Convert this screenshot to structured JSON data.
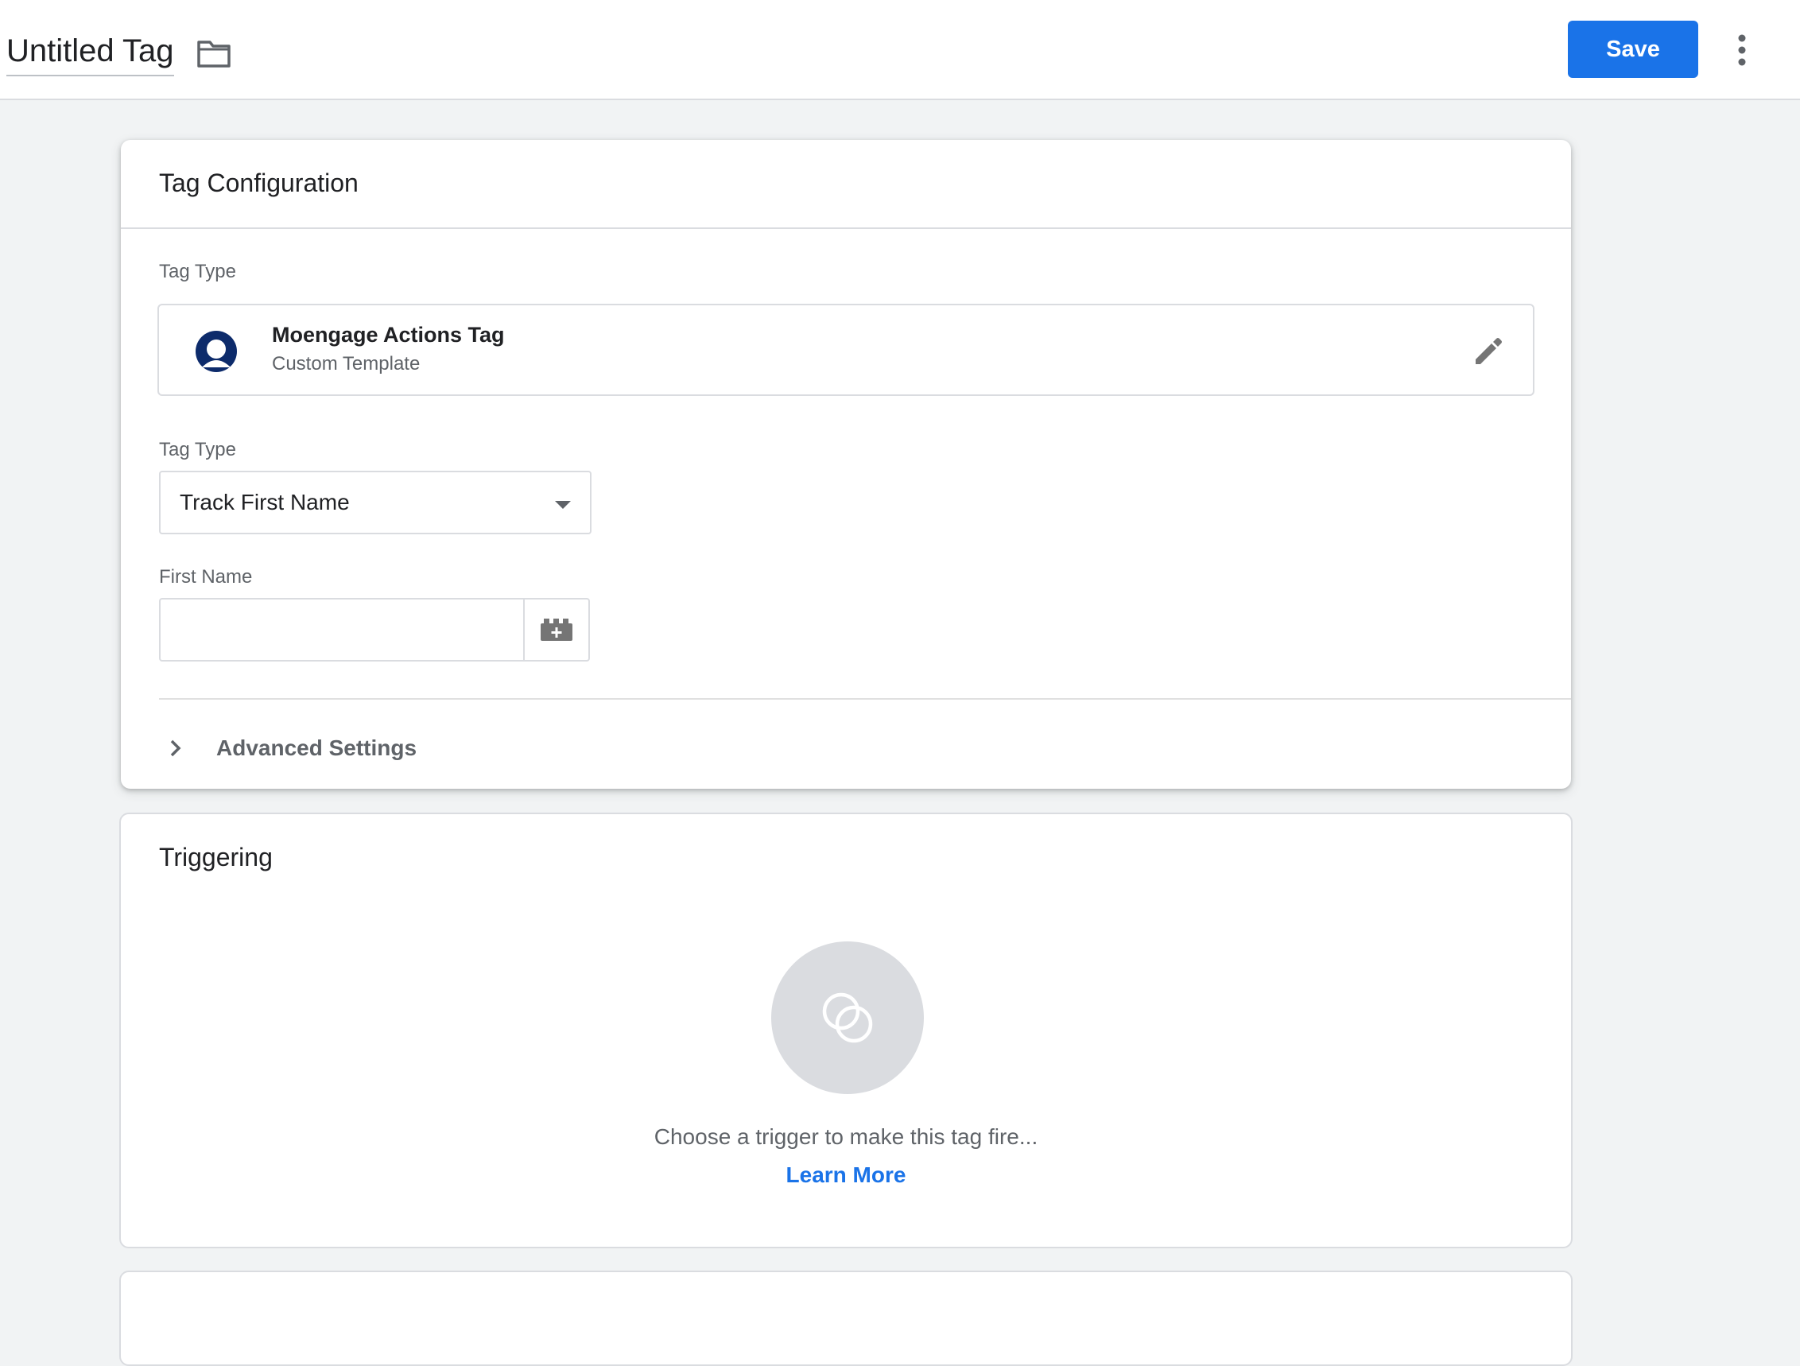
{
  "header": {
    "title": "Untitled Tag",
    "folder_icon": "folder-icon",
    "save_label": "Save",
    "more_icon": "more-vert-icon"
  },
  "config_card": {
    "title": "Tag Configuration",
    "tag_type_label": "Tag Type",
    "template": {
      "name": "Moengage Actions Tag",
      "subtitle": "Custom Template",
      "logo_icon": "moengage-logo-icon",
      "edit_icon": "pencil-icon"
    },
    "action_type": {
      "label": "Tag Type",
      "selected": "Track First Name",
      "arrow_icon": "dropdown-arrow-icon"
    },
    "first_name": {
      "label": "First Name",
      "value": "",
      "variable_icon": "add-variable-icon"
    },
    "advanced": {
      "label": "Advanced Settings",
      "chevron_icon": "chevron-right-icon"
    }
  },
  "trigger_card": {
    "title": "Triggering",
    "empty_icon": "trigger-circles-icon",
    "empty_text": "Choose a trigger to make this tag fire...",
    "learn_more": "Learn More"
  },
  "colors": {
    "accent": "#1a73e8",
    "background": "#f1f3f4",
    "moengage_logo": "#0d2b6b"
  }
}
